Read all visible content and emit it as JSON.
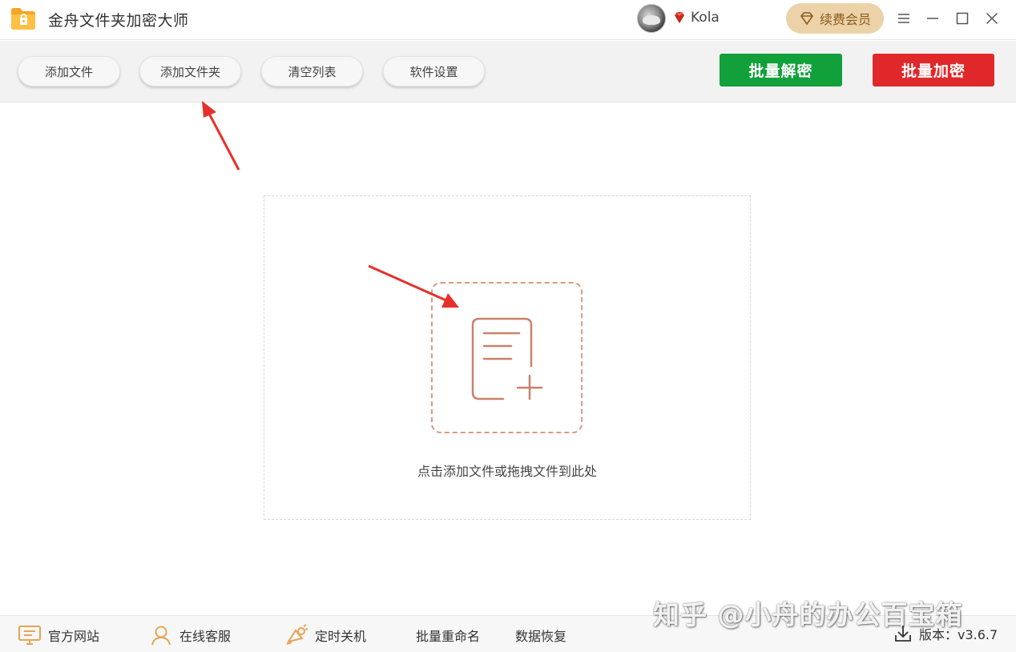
{
  "app": {
    "title": "金舟文件夹加密大师",
    "username": "Kola",
    "renew_label": "续费会员"
  },
  "toolbar": {
    "add_file": "添加文件",
    "add_folder": "添加文件夹",
    "clear_list": "清空列表",
    "settings": "软件设置",
    "batch_decrypt": "批量解密",
    "batch_encrypt": "批量加密"
  },
  "main": {
    "drop_hint": "点击添加文件或拖拽文件到此处"
  },
  "footer": {
    "website": "官方网站",
    "support": "在线客服",
    "shutdown": "定时关机",
    "rename": "批量重命名",
    "recovery": "数据恢复",
    "version": "版本：v3.6.7"
  },
  "watermark": "知乎 @小舟的办公百宝箱",
  "colors": {
    "decrypt": "#12a03a",
    "encrypt": "#e0282a",
    "accent": "#d99a82",
    "vip": "#ecd2a8",
    "annotation": "#e8302a"
  },
  "icons": {
    "logo": "folder-lock-icon",
    "vip": "gem-icon",
    "renew": "diamond-icon",
    "menu": "menu-icon",
    "minimize": "minimize-icon",
    "maximize": "maximize-icon",
    "close": "close-icon",
    "add_file": "file-add-icon",
    "website": "monitor-icon",
    "support": "headset-user-icon",
    "shutdown": "alarm-icon",
    "version": "download-icon"
  }
}
